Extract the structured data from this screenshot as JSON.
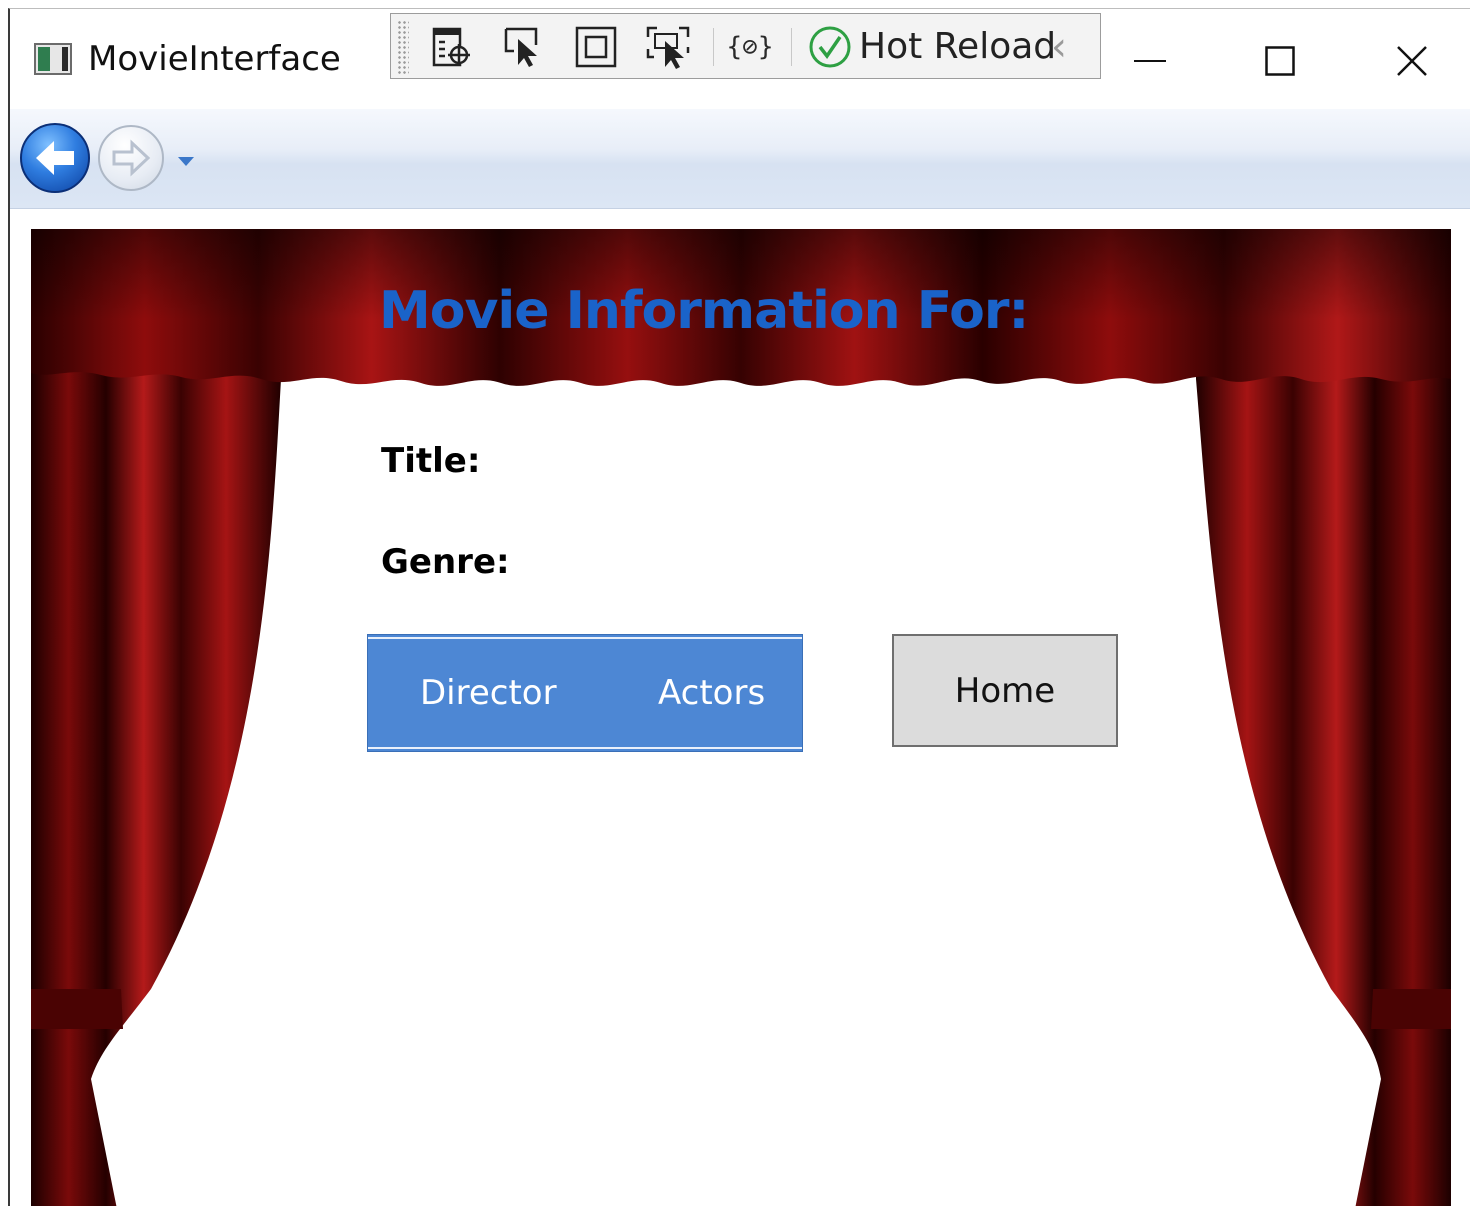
{
  "window": {
    "title": "MovieInterface"
  },
  "devtools": {
    "hot_reload_label": "Hot Reload",
    "status_color": "#2ea043",
    "icons": [
      "live-visual-tree-icon",
      "select-element-icon",
      "display-layout-adorners-icon",
      "track-focused-element-icon",
      "binding-failures-icon",
      "hot-reload-status-icon",
      "collapse-toolbar-icon"
    ],
    "binding_glyph": "{⊘}"
  },
  "page": {
    "heading": "Movie Information For:",
    "title_label": "Title:",
    "genre_label": "Genre:",
    "tabs": [
      {
        "label": "Director"
      },
      {
        "label": "Actors"
      }
    ],
    "home_label": "Home"
  },
  "colors": {
    "heading": "#1a63c9",
    "tab_group_bg": "#4d87d4",
    "home_button_bg": "#dcdcdc",
    "curtain_red": "#8e0c0c"
  }
}
